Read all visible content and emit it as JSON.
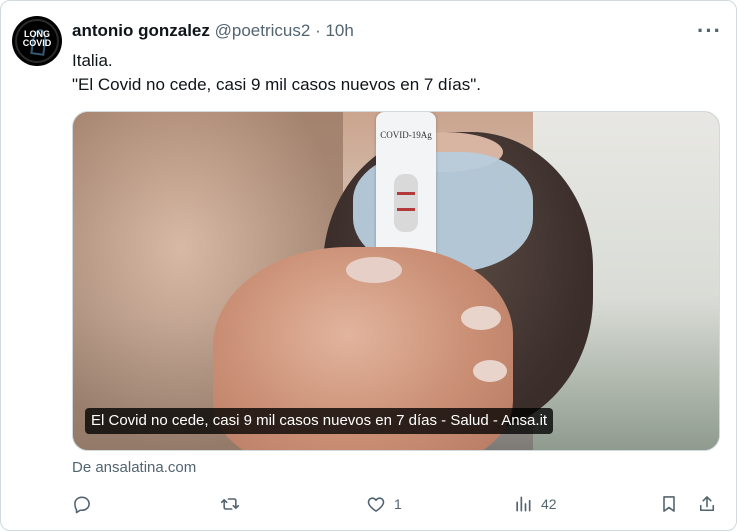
{
  "author": {
    "name": "antonio gonzalez",
    "handle": "@poetricus2",
    "separator": "·",
    "time": "10h",
    "avatar_text_line1": "LONG",
    "avatar_text_line2": "COVID"
  },
  "tweet": {
    "line1": "Italia.",
    "line2": "\"El Covid no cede, casi 9 mil casos nuevos en 7 días\"."
  },
  "media": {
    "caption": "El Covid no cede, casi 9 mil casos nuevos en 7 días - Salud - Ansa.it",
    "test_label": "COVID-19Ag"
  },
  "link_source": "De ansalatina.com",
  "actions": {
    "reply_icon": "reply-icon",
    "retweet_icon": "retweet-icon",
    "like_icon": "heart-icon",
    "like_count": "1",
    "views_icon": "views-icon",
    "views_count": "42",
    "bookmark_icon": "bookmark-icon",
    "share_icon": "share-icon"
  },
  "colors": {
    "text": "#0f1419",
    "secondary": "#536471",
    "border": "#cfd9de"
  }
}
